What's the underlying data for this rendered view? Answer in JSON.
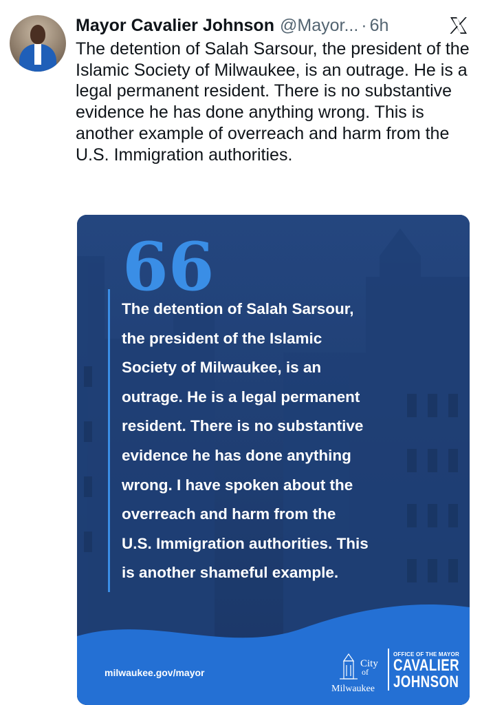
{
  "tweet": {
    "author_name": "Mayor Cavalier Johnson",
    "handle": "@Mayor...",
    "separator": "·",
    "time": "6h",
    "text": "The detention of Salah Sarsour, the president of the Islamic Society of Milwaukee, is an outrage.  He is a legal permanent resident. There is no substantive evidence he has done anything wrong. This is another example of overreach and harm from the U.S. Immigration authorities."
  },
  "brand": {
    "icon": "x-logo-icon"
  },
  "card": {
    "quote_icon": "quote-icon",
    "quote_mark": "66",
    "quote_lines": [
      "The detention of Salah Sarsour,",
      "the president of the Islamic",
      "Society of Milwaukee, is an",
      "outrage. He is a legal permanent",
      "resident. There is no substantive",
      "evidence he has done anything",
      "wrong. I have spoken about the",
      "overreach and harm from the",
      "U.S. Immigration authorities. This",
      "is another shameful example."
    ],
    "url": "milwaukee.gov/mayor",
    "city_logo_text": [
      "City",
      "of",
      "Milwaukee"
    ],
    "office_label": "OFFICE OF THE MAYOR",
    "office_name": [
      "CAVALIER",
      "JOHNSON"
    ]
  },
  "colors": {
    "card_background": "#1c3c72",
    "card_wave": "#2470d4",
    "quote_accent": "#3a8ee6",
    "text_primary": "#0f1419",
    "text_secondary": "#536471"
  }
}
